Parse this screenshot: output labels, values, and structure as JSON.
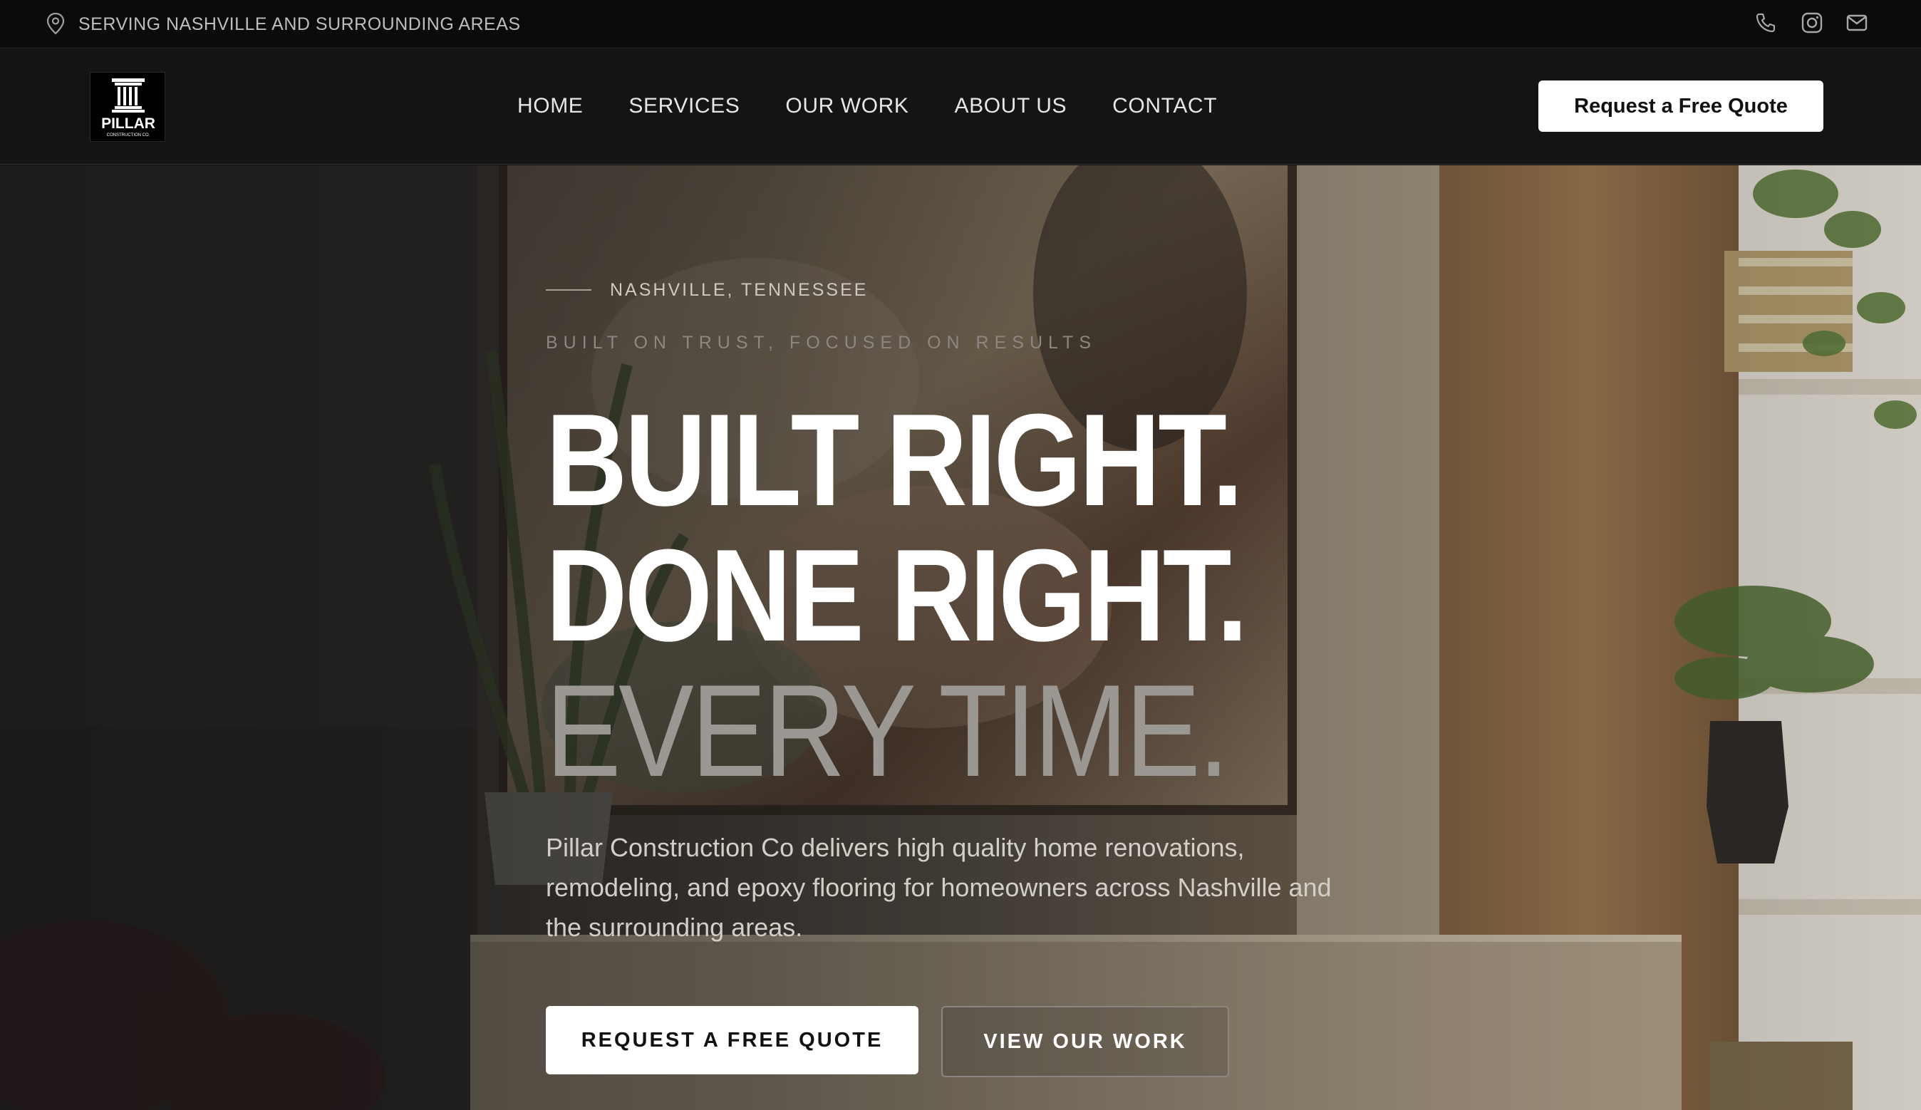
{
  "topbar": {
    "location_text": "SERVING NASHVILLE AND SURROUNDING AREAS",
    "icons": [
      "location-pin-icon",
      "phone-icon",
      "instagram-icon",
      "mail-icon"
    ]
  },
  "logo": {
    "name": "PILLAR",
    "sub": "CONSTRUCTION CO."
  },
  "nav": {
    "items": [
      {
        "label": "HOME"
      },
      {
        "label": "SERVICES"
      },
      {
        "label": "OUR WORK"
      },
      {
        "label": "ABOUT US"
      },
      {
        "label": "CONTACT"
      }
    ],
    "cta_label": "Request a Free Quote"
  },
  "hero": {
    "eyebrow": "NASHVILLE, TENNESSEE",
    "tagline": "BUILT ON TRUST, FOCUSED ON RESULTS",
    "headline_line1": "BUILT RIGHT.",
    "headline_line2": "DONE RIGHT.",
    "headline_line3": "EVERY TIME.",
    "description": "Pillar Construction Co delivers high quality home renovations, remodeling, and epoxy flooring for homeowners across Nashville and the surrounding areas.",
    "primary_button": "REQUEST A FREE QUOTE",
    "secondary_button": "VIEW OUR WORK"
  },
  "colors": {
    "topbar_bg": "#0b0b0b",
    "nav_bg": "#141414",
    "accent_white": "#ffffff",
    "muted_headline": "#9b9894"
  }
}
